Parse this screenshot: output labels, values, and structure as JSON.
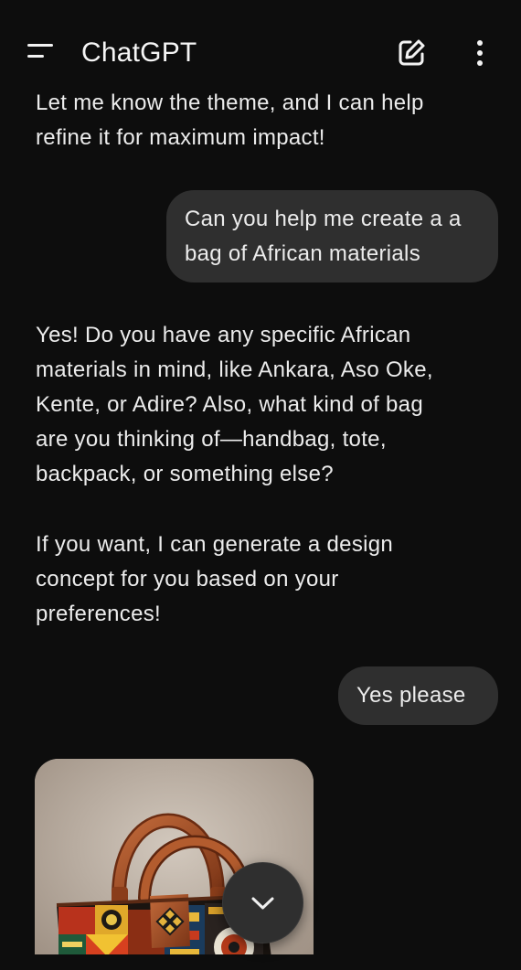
{
  "header": {
    "title": "ChatGPT",
    "menu_icon": "menu-icon",
    "new_chat_icon": "compose-icon",
    "more_icon": "more-vertical-icon"
  },
  "messages": [
    {
      "role": "assistant",
      "lines": [
        "Let me know the theme, and I can help",
        "refine it for maximum impact!"
      ]
    },
    {
      "role": "user",
      "lines": [
        "Can you help me create a a",
        "bag of African materials"
      ]
    },
    {
      "role": "assistant",
      "paragraphs": [
        [
          "Yes! Do you have any specific African",
          "materials in mind, like Ankara, Aso Oke,",
          "Kente, or Adire? Also, what kind of bag",
          "are you thinking of—handbag, tote,",
          "backpack, or something else?"
        ],
        [
          "If you want, I can generate a design",
          "concept for you based on your",
          "preferences!"
        ]
      ]
    },
    {
      "role": "user",
      "text": "Yes please"
    },
    {
      "role": "assistant",
      "image": "generated-african-bag-image"
    }
  ],
  "scroll_button_icon": "chevron-down-icon",
  "colors": {
    "background": "#0d0d0d",
    "user_bubble": "#2f2f2f",
    "text": "#ececec"
  }
}
